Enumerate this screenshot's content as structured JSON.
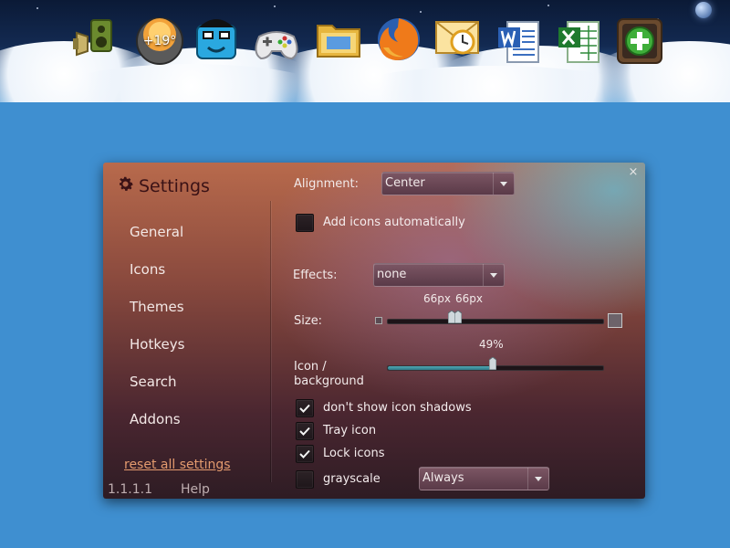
{
  "dock": {
    "weather_temp": "+19°",
    "icons": [
      {
        "name": "speaker-icon"
      },
      {
        "name": "weather-icon"
      },
      {
        "name": "monster-icon"
      },
      {
        "name": "gamepad-icon"
      },
      {
        "name": "folder-icon"
      },
      {
        "name": "firefox-icon"
      },
      {
        "name": "outlook-icon"
      },
      {
        "name": "word-icon"
      },
      {
        "name": "excel-icon"
      },
      {
        "name": "add-icon"
      }
    ]
  },
  "settings": {
    "title": "Settings",
    "close_glyph": "×",
    "nav": [
      "General",
      "Icons",
      "Themes",
      "Hotkeys",
      "Search",
      "Addons"
    ],
    "reset_link": "reset all settings",
    "version": "1.1.1.1",
    "help": "Help",
    "alignment": {
      "label": "Alignment:",
      "value": "Center"
    },
    "add_icons": {
      "label": "Add icons automatically",
      "checked": false
    },
    "effects": {
      "label": "Effects:",
      "value": "none"
    },
    "size": {
      "label": "Size:",
      "value_a": "66px",
      "value_b": "66px",
      "level": 0.31
    },
    "icon_bg": {
      "label_line1": "Icon /",
      "label_line2": "background",
      "value": "49%",
      "level": 0.49
    },
    "checks": [
      {
        "label": "don't show icon shadows",
        "checked": true
      },
      {
        "label": "Tray icon",
        "checked": true
      },
      {
        "label": "Lock icons",
        "checked": true
      }
    ],
    "grayscale": {
      "label": "grayscale",
      "checked": false,
      "mode": "Always"
    }
  },
  "colors": {
    "page_bg": "#3f8fd0",
    "link": "#e39a6e",
    "slider_fill": "#3d8f9c"
  }
}
